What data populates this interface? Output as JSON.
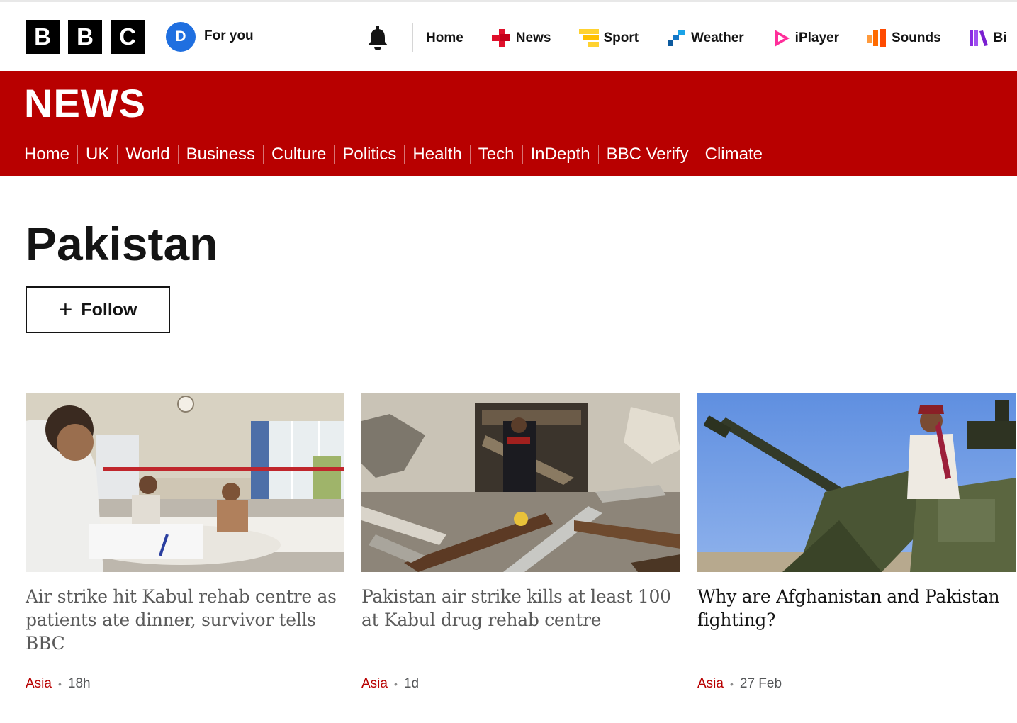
{
  "masthead": {
    "logo_letters": [
      "B",
      "B",
      "C"
    ],
    "avatar_initial": "D",
    "for_you": "For you",
    "nav": [
      {
        "label": "Home",
        "icon": "none"
      },
      {
        "label": "News",
        "icon": "news-blocks-icon",
        "color": "#e0102b"
      },
      {
        "label": "Sport",
        "icon": "sport-blocks-icon",
        "color": "#ffd230"
      },
      {
        "label": "Weather",
        "icon": "weather-blocks-icon",
        "color": "#1577c6"
      },
      {
        "label": "iPlayer",
        "icon": "iplayer-play-icon",
        "color": "#ff2e9a"
      },
      {
        "label": "Sounds",
        "icon": "sounds-bars-icon",
        "color": "#ff6a00"
      },
      {
        "label": "Bi",
        "icon": "bitesize-bars-icon",
        "color": "#8a2be2"
      }
    ]
  },
  "news": {
    "title": "NEWS",
    "nav": [
      "Home",
      "UK",
      "World",
      "Business",
      "Culture",
      "Politics",
      "Health",
      "Tech",
      "InDepth",
      "BBC Verify",
      "Climate"
    ]
  },
  "page": {
    "title": "Pakistan",
    "follow_plus": "+",
    "follow_label": "Follow"
  },
  "cards": [
    {
      "headline": "Air strike hit Kabul rehab centre as patients ate dinner, survivor tells BBC",
      "region": "Asia",
      "time": "18h",
      "visited": true
    },
    {
      "headline": "Pakistan air strike kills at least 100 at Kabul drug rehab centre",
      "region": "Asia",
      "time": "1d",
      "visited": true
    },
    {
      "headline": "Why are Afghanistan and Pakistan fighting?",
      "region": "Asia",
      "time": "27 Feb",
      "visited": false
    }
  ],
  "colors": {
    "brand_red": "#b80000",
    "text": "#141414",
    "visited": "#5a5a5a"
  }
}
